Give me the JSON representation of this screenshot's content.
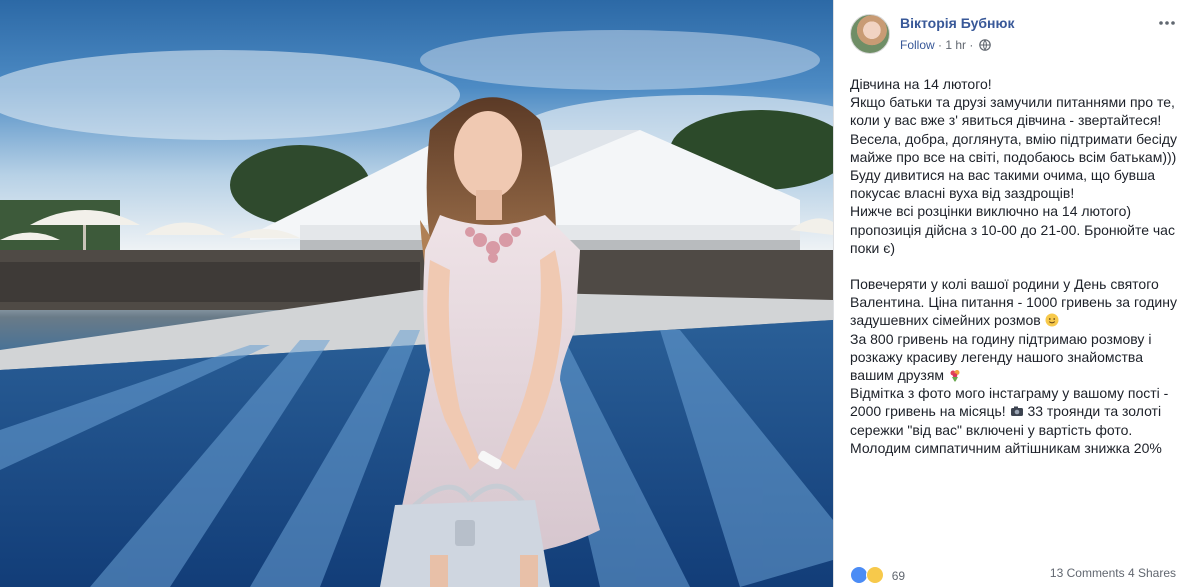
{
  "photo": {
    "alt_name": "post-photo"
  },
  "post": {
    "author": "Вікторія Бубнюк",
    "follow_label": "Follow",
    "separator": "·",
    "time": "1 hr",
    "paragraph1": [
      "Дівчина на 14 лютого!",
      "Якщо батьки та друзі замучили питаннями про те, коли у вас вже з' явиться дівчина - звертайтеся! Весела, добра, доглянута, вмію підтримати бесіду майже про все на світі, подобаюсь всім батькам))) Буду дивитися на вас такими очима, що бувша покусає власні вуха від заздрощів!",
      "Нижче всі розцінки виключно на 14 лютого) пропозиція дійсна з 10-00 до 21-00. Бронюйте час поки є)"
    ],
    "p2_line1": "Повечеряти у колі вашої родини у День святого Валентина. Ціна питання - 1000 гривень за годину задушевних сімейних розмов",
    "p2_line2": "За 800 гривень на годину підтримаю розмову і розкажу красиву легенду нашого знайомства вашим друзям",
    "p2_line3a": "Відмітка з фото мого інстаграму у вашому пості - 2000 гривень на місяць!",
    "p2_line3b": "33 троянди та золоті сережки \"від вас\" включені у вартість фото.",
    "p2_line4": "Молодим симпатичним айтішникам знижка 20%"
  },
  "footer": {
    "reaction_count": "69",
    "comments": "13 Comments",
    "shares": "4 Shares"
  },
  "colors": {
    "link": "#385898",
    "text": "#1d2129",
    "meta": "#616770",
    "like": "#4b8cf5",
    "wow": "#f7c94b"
  },
  "icons": {
    "more": "ellipsis-icon",
    "globe": "globe-icon",
    "smile": "blush-emoji",
    "bouquet": "bouquet-emoji",
    "camera": "camera-emoji"
  }
}
